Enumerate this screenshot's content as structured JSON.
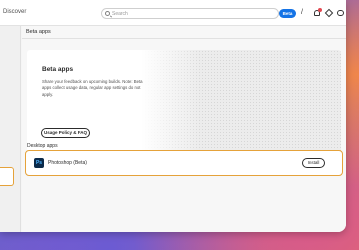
{
  "window": {
    "title": "Discover"
  },
  "search": {
    "placeholder": "Search",
    "icon": "search-icon"
  },
  "toolbar": {
    "beta_label": "Beta",
    "slash_label": "/",
    "icons": [
      "bell-icon",
      "settings-icon",
      "cloud-icon"
    ]
  },
  "main": {
    "page_title": "Beta apps",
    "banner": {
      "title": "Beta apps",
      "description": "Share your feedback on upcoming builds. Note: Beta apps collect usage data, regular app settings do not apply.",
      "button_label": "Usage Policy & FAQ"
    },
    "section_label": "Desktop apps",
    "apps": [
      {
        "icon_text": "Ps",
        "name": "Photoshop (Beta)",
        "action_label": "Install"
      }
    ]
  },
  "colors": {
    "accent": "#1473e6",
    "highlight": "#e5a23a",
    "notification": "#e34850"
  }
}
